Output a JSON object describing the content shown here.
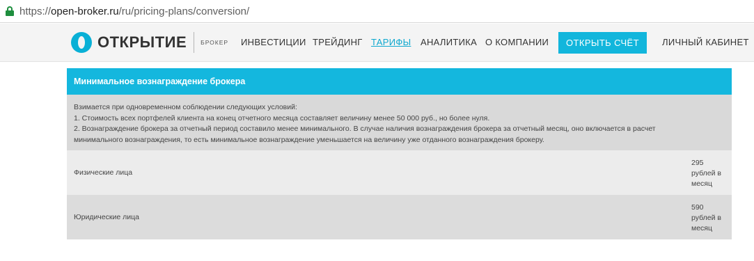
{
  "browser": {
    "url_prefix": "https://",
    "url_host": "open-broker.ru",
    "url_path": "/ru/pricing-plans/conversion/"
  },
  "header": {
    "logo_name": "ОТКРЫТИЕ",
    "logo_sub": "БРОКЕР",
    "nav": [
      "ИНВЕСТИЦИИ",
      "ТРЕЙДИНГ",
      "ТАРИФЫ",
      "АНАЛИТИКА",
      "О КОМПАНИИ"
    ],
    "active_nav": "ТАРИФЫ",
    "open_account": "ОТКРЫТЬ СЧЁТ",
    "cabinet": "ЛИЧНЫЙ КАБИНЕТ",
    "accent_color": "#12b6dc"
  },
  "table": {
    "title": "Минимальное вознаграждение брокера",
    "conditions": [
      "Взимается при одновременном соблюдении следующих условий:",
      "1. Стоимость всех портфелей клиента на конец отчетного месяца составляет величину менее 50 000 руб., но более нуля.",
      "2. Вознаграждение брокера за отчетный период составило менее минимального. В случае наличия вознаграждения брокера за отчетный месяц, оно включается в расчет",
      "минимального вознаграждения, то есть минимальное вознаграждение уменьшается на величину уже отданного вознаграждения брокеру."
    ],
    "rows": [
      {
        "label": "Физические лица",
        "price_lines": [
          "295",
          "рублей в",
          "месяц"
        ]
      },
      {
        "label": "Юридические лица",
        "price_lines": [
          "590",
          "рублей в",
          "месяц"
        ]
      }
    ]
  }
}
